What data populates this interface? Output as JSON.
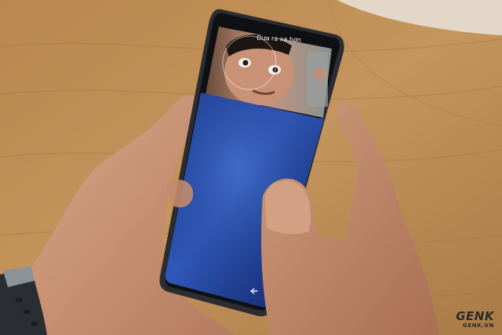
{
  "photo": {
    "face_unlock_prompt": "Đưa ra xa hơn",
    "back_icon": "back-arrow-icon",
    "colors": {
      "table_wood": "#b98a52",
      "phone_frame": "#2b2d31",
      "lock_screen_blue": "#1d3a8a",
      "skin": "#c89476",
      "watch_band": "#2a2e33"
    }
  },
  "watermark": {
    "brand": "GENK",
    "site": "GENK.VN"
  }
}
